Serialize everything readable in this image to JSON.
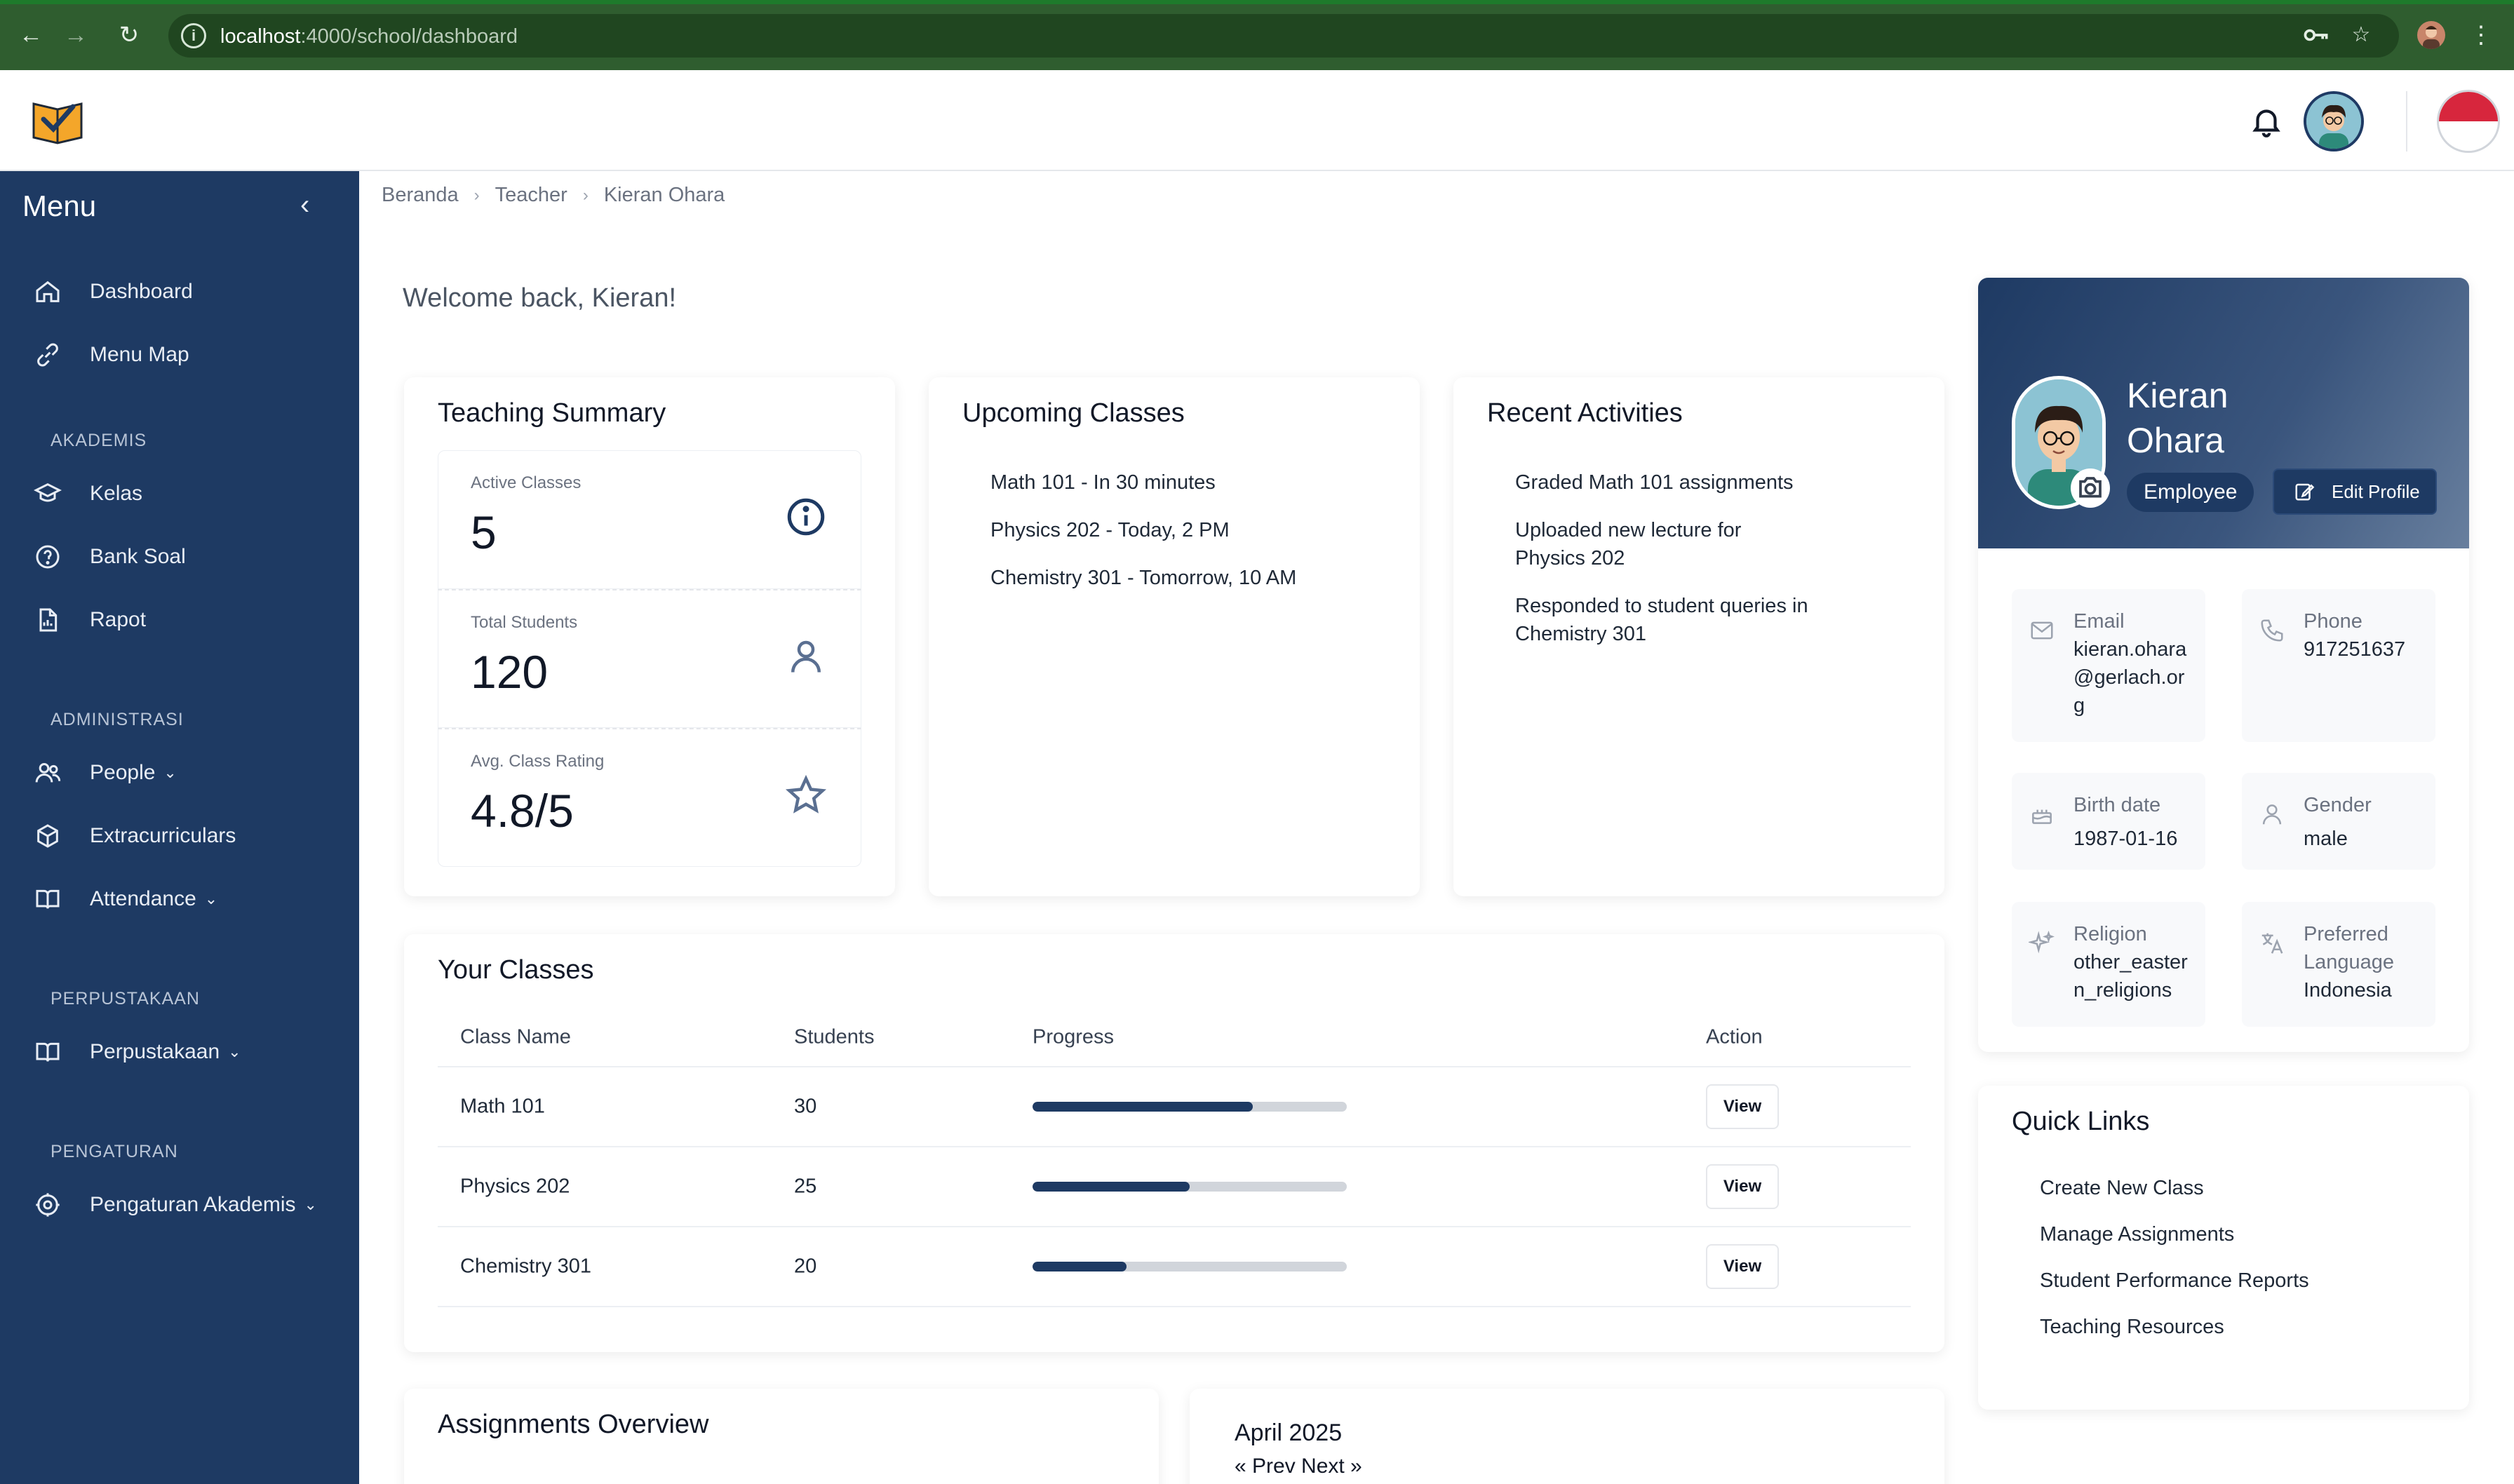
{
  "browser": {
    "url_host": "localhost",
    "url_path": ":4000/school/dashboard"
  },
  "sidebar": {
    "title": "Menu",
    "items_top": [
      {
        "label": "Dashboard",
        "icon": "home-icon"
      },
      {
        "label": "Menu Map",
        "icon": "link-icon"
      }
    ],
    "section_akademis": "AKADEMIS",
    "items_akademis": [
      {
        "label": "Kelas",
        "icon": "graduation-cap-icon"
      },
      {
        "label": "Bank Soal",
        "icon": "question-circle-icon"
      },
      {
        "label": "Rapot",
        "icon": "report-file-icon"
      }
    ],
    "section_administrasi": "ADMINISTRASI",
    "items_administrasi": [
      {
        "label": "People",
        "icon": "people-icon"
      },
      {
        "label": "Extracurriculars",
        "icon": "cube-icon"
      },
      {
        "label": "Attendance",
        "icon": "book-open-icon"
      }
    ],
    "section_perpustakaan": "PERPUSTAKAAN",
    "items_perpustakaan": [
      {
        "label": "Perpustakaan",
        "icon": "book-open-icon"
      }
    ],
    "section_pengaturan": "PENGATURAN",
    "items_pengaturan": [
      {
        "label": "Pengaturan Akademis",
        "icon": "settings-icon"
      }
    ]
  },
  "breadcrumb": [
    "Beranda",
    "Teacher",
    "Kieran Ohara"
  ],
  "welcome": "Welcome back, Kieran!",
  "teaching_summary": {
    "title": "Teaching Summary",
    "stats": [
      {
        "label": "Active Classes",
        "value": "5",
        "icon": "info-icon"
      },
      {
        "label": "Total Students",
        "value": "120",
        "icon": "user-icon"
      },
      {
        "label": "Avg. Class Rating",
        "value": "4.8/5",
        "icon": "star-icon"
      }
    ]
  },
  "upcoming_classes": {
    "title": "Upcoming Classes",
    "items": [
      "Math 101 - In 30 minutes",
      "Physics 202 - Today, 2 PM",
      "Chemistry 301 - Tomorrow, 10 AM"
    ]
  },
  "recent_activities": {
    "title": "Recent Activities",
    "items": [
      "Graded Math 101 assignments",
      "Uploaded new lecture for Physics 202",
      "Responded to student queries in Chemistry 301"
    ]
  },
  "your_classes": {
    "title": "Your Classes",
    "columns": [
      "Class Name",
      "Students",
      "Progress",
      "Action"
    ],
    "rows": [
      {
        "name": "Math 101",
        "students": "30",
        "progress": 0.7,
        "action": "View"
      },
      {
        "name": "Physics 202",
        "students": "25",
        "progress": 0.5,
        "action": "View"
      },
      {
        "name": "Chemistry 301",
        "students": "20",
        "progress": 0.3,
        "action": "View"
      }
    ]
  },
  "assignments_overview": {
    "title": "Assignments Overview"
  },
  "calendar": {
    "month": "April 2025",
    "nav": "« Prev Next »"
  },
  "profile": {
    "first_name": "Kieran",
    "last_name": "Ohara",
    "role": "Employee",
    "edit_label": "Edit Profile",
    "email_label": "Email",
    "email": "kieran.ohara@gerlach.org",
    "phone_label": "Phone",
    "phone": "917251637",
    "birth_label": "Birth date",
    "birth": "1987-01-16",
    "gender_label": "Gender",
    "gender": "male",
    "religion_label": "Religion",
    "religion": "other_eastern_religions",
    "language_label": "Preferred Language",
    "language": "Indonesia"
  },
  "quick_links": {
    "title": "Quick Links",
    "items": [
      "Create New Class",
      "Manage Assignments",
      "Student Performance Reports",
      "Teaching Resources"
    ]
  },
  "colors": {
    "sidebar": "#1e3a63",
    "browser_chrome": "#2f5d2f",
    "accent": "#1e3a63"
  }
}
